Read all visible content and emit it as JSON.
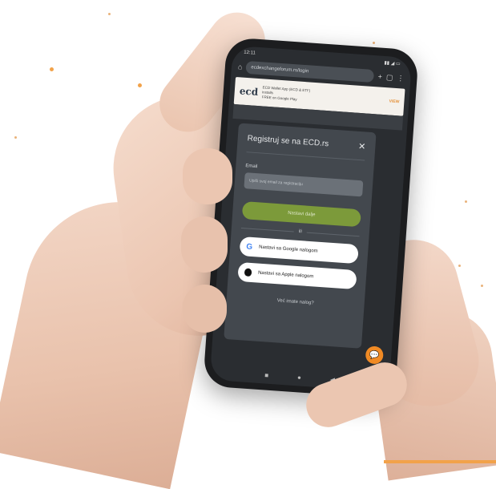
{
  "browser": {
    "time": "12:11",
    "url": "ecdexchangeforum.rs/login",
    "icons": [
      "home-icon",
      "plus-icon",
      "tabs-icon",
      "menu-icon"
    ]
  },
  "ad": {
    "logo": "ecd",
    "line1": "ECD Wallet App (ECD & ETF)",
    "line2": "installs",
    "line3": "FREE on Google Play",
    "cta": "VIEW"
  },
  "modal": {
    "title": "Registruj se na ECD.rs",
    "email_label": "Email",
    "email_placeholder": "Upiši svoj email za registraciju",
    "submit_label": "Nastavi dalje",
    "divider_label": "ili",
    "google_label": "Nastavi sa Google nalogom",
    "apple_label": "Nastavi sa Apple nalogom",
    "footer_link": "Već imate nalog?"
  },
  "colors": {
    "accent": "#f08a24",
    "primary_button": "#7c9a3a",
    "modal_bg": "#43484e"
  }
}
